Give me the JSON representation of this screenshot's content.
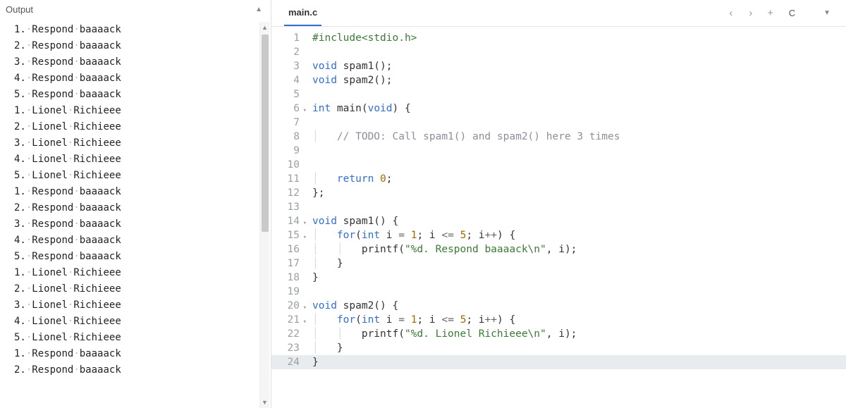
{
  "output": {
    "title": "Output",
    "lines": [
      "1. Respond baaaack",
      "2. Respond baaaack",
      "3. Respond baaaack",
      "4. Respond baaaack",
      "5. Respond baaaack",
      "1. Lionel Richieee",
      "2. Lionel Richieee",
      "3. Lionel Richieee",
      "4. Lionel Richieee",
      "5. Lionel Richieee",
      "1. Respond baaaack",
      "2. Respond baaaack",
      "3. Respond baaaack",
      "4. Respond baaaack",
      "5. Respond baaaack",
      "1. Lionel Richieee",
      "2. Lionel Richieee",
      "3. Lionel Richieee",
      "4. Lionel Richieee",
      "5. Lionel Richieee",
      "1. Respond baaaack",
      "2. Respond baaaack"
    ]
  },
  "editor": {
    "filename": "main.c",
    "language": "C",
    "nav_prev": "‹",
    "nav_next": "›",
    "add_tab": "+",
    "code": [
      {
        "n": 1,
        "html": "<span class='pp'>#include</span><span class='pp'>&lt;stdio.h&gt;</span>"
      },
      {
        "n": 2,
        "html": ""
      },
      {
        "n": 3,
        "html": "<span class='ty'>void</span> spam1();"
      },
      {
        "n": 4,
        "html": "<span class='ty'>void</span> spam2();"
      },
      {
        "n": 5,
        "html": ""
      },
      {
        "n": 6,
        "fold": true,
        "html": "<span class='ty'>int</span> main(<span class='ty'>void</span>) {"
      },
      {
        "n": 7,
        "html": ""
      },
      {
        "n": 8,
        "html": "    <span class='cm'>// TODO: Call spam1() and spam2() here 3 times</span>"
      },
      {
        "n": 9,
        "html": ""
      },
      {
        "n": 10,
        "html": ""
      },
      {
        "n": 11,
        "html": "    <span class='kw'>return</span> <span class='num'>0</span>;"
      },
      {
        "n": 12,
        "html": "};"
      },
      {
        "n": 13,
        "html": ""
      },
      {
        "n": 14,
        "fold": true,
        "html": "<span class='ty'>void</span> spam1() {"
      },
      {
        "n": 15,
        "fold": true,
        "html": "    <span class='kw'>for</span>(<span class='ty'>int</span> i <span class='op'>=</span> <span class='num'>1</span>; i <span class='op'>&lt;=</span> <span class='num'>5</span>; i<span class='op'>++</span>) {"
      },
      {
        "n": 16,
        "html": "        printf(<span class='str'>\"%d. Respond baaaack\\n\"</span>, i);"
      },
      {
        "n": 17,
        "html": "    }"
      },
      {
        "n": 18,
        "html": "}"
      },
      {
        "n": 19,
        "html": ""
      },
      {
        "n": 20,
        "fold": true,
        "html": "<span class='ty'>void</span> spam2() {"
      },
      {
        "n": 21,
        "fold": true,
        "html": "    <span class='kw'>for</span>(<span class='ty'>int</span> i <span class='op'>=</span> <span class='num'>1</span>; i <span class='op'>&lt;=</span> <span class='num'>5</span>; i<span class='op'>++</span>) {"
      },
      {
        "n": 22,
        "html": "        printf(<span class='str'>\"%d. Lionel Richieee\\n\"</span>, i);"
      },
      {
        "n": 23,
        "html": "    }"
      },
      {
        "n": 24,
        "hl": true,
        "html": "}"
      }
    ]
  }
}
